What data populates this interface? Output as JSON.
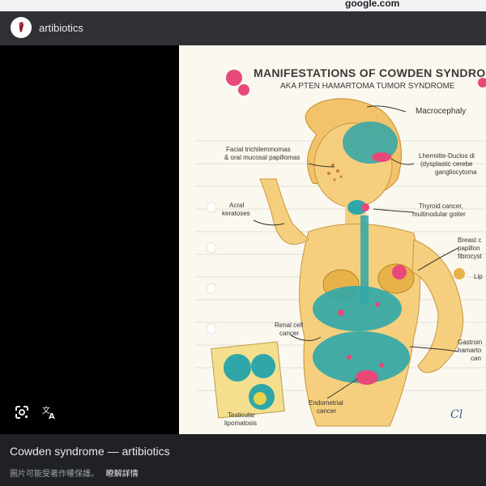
{
  "browser": {
    "domain": "google.com"
  },
  "header": {
    "source_name": "artibiotics",
    "avatar_icon": "artibiotics-logo"
  },
  "artwork": {
    "title": "MANIFESTATIONS OF COWDEN SYNDROME",
    "subtitle": "AKA PTEN HAMARTOMA TUMOR SYNDROME",
    "labels": {
      "macrocephaly": "Macrocephaly",
      "facial_1": "Facial trichilemmomas",
      "facial_2": "& oral mucosal papillomas",
      "lhermitte_1": "Lhermitte-Duclos di",
      "lhermitte_2": "(dysplastic cerebe",
      "lhermitte_3": "gangliocytoma",
      "acral_1": "Acral",
      "acral_2": "keratoses",
      "thyroid_1": "Thyroid cancer,",
      "thyroid_2": "multinodular goiter",
      "breast_1": "Breast c",
      "breast_2": "papillon",
      "breast_3": "fibrocyst",
      "lip": "Lip",
      "renal_1": "Renal cell",
      "renal_2": "cancer",
      "gastro_1": "Gastroin",
      "gastro_2": "hamarto",
      "gastro_3": "can",
      "endometrial_1": "Endometrial",
      "endometrial_2": "cancer",
      "testicular_1": "Testicular",
      "testicular_2": "lipomatosis",
      "signature": "Cl"
    }
  },
  "tools": {
    "lens_icon": "google-lens-icon",
    "translate_icon": "translate-icon"
  },
  "footer": {
    "caption": "Cowden syndrome — artibiotics",
    "copyright_notice": "圖片可能受著作權保護。",
    "learn_more": "瞭解詳情"
  },
  "colors": {
    "header_bg": "#303134",
    "footer_bg": "#202124",
    "viewer_bg": "#000000",
    "art_bg": "#fbf8f0",
    "title_ink": "#3a3a3a",
    "organ_teal": "#2fa6a8",
    "tumor_pink": "#e8487a",
    "skin": "#f6cf7e"
  }
}
